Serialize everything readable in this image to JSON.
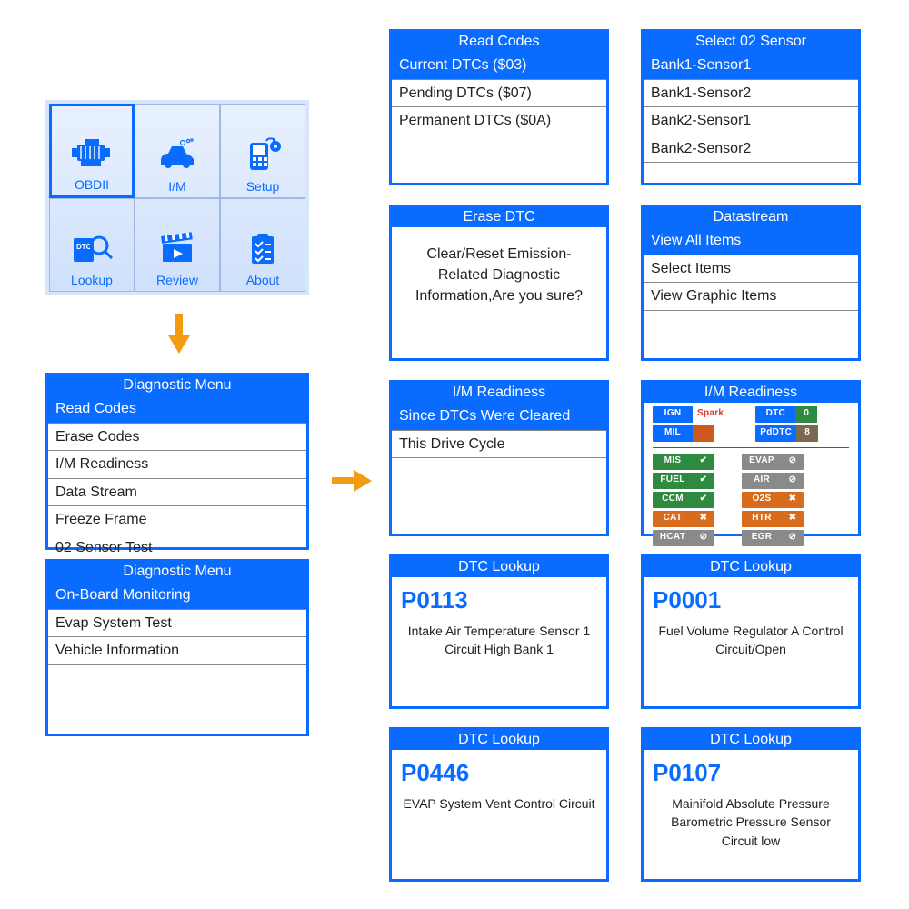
{
  "main_menu": {
    "items": [
      {
        "label": "OBDII",
        "selected": true
      },
      {
        "label": "I/M",
        "selected": false
      },
      {
        "label": "Setup",
        "selected": false
      },
      {
        "label": "Lookup",
        "selected": false
      },
      {
        "label": "Review",
        "selected": false
      },
      {
        "label": "About",
        "selected": false
      }
    ]
  },
  "diag_menu_1": {
    "title": "Diagnostic Menu",
    "items": [
      "Read Codes",
      "Erase Codes",
      "I/M Readiness",
      "Data Stream",
      "Freeze Frame",
      "02 Sensor Test"
    ],
    "selected_index": 0
  },
  "diag_menu_2": {
    "title": "Diagnostic Menu",
    "items": [
      "On-Board Monitoring",
      "Evap System Test",
      "Vehicle Information"
    ],
    "selected_index": 0
  },
  "read_codes": {
    "title": "Read Codes",
    "items": [
      "Current DTCs ($03)",
      "Pending DTCs ($07)",
      "Permanent DTCs ($0A)"
    ],
    "selected_index": 0
  },
  "select_o2": {
    "title": "Select 02 Sensor",
    "items": [
      "Bank1-Sensor1",
      "Bank1-Sensor2",
      "Bank2-Sensor1",
      "Bank2-Sensor2"
    ],
    "selected_index": 0
  },
  "erase_dtc": {
    "title": "Erase DTC",
    "message": "Clear/Reset Emission-Related Diagnostic Information,Are you sure?"
  },
  "datastream": {
    "title": "Datastream",
    "items": [
      "View All Items",
      "Select Items",
      "View Graphic Items"
    ],
    "selected_index": 0
  },
  "im_ready_menu": {
    "title": "I/M Readiness",
    "items": [
      "Since DTCs Were Cleared",
      "This Drive Cycle"
    ],
    "selected_index": 0
  },
  "im_ready_dash": {
    "title": "I/M Readiness",
    "top_left": [
      {
        "label": "IGN",
        "value": "Spark",
        "label_bg": "#0a6cff",
        "val_bg": "#fff",
        "val_color": "#d33"
      },
      {
        "label": "MIL",
        "value": "",
        "label_bg": "#0a6cff",
        "val_bg": "#cc5a1f"
      }
    ],
    "top_right": [
      {
        "label": "DTC",
        "value": "0",
        "label_bg": "#0a6cff",
        "val_bg": "#2d8a3e"
      },
      {
        "label": "PdDTC",
        "value": "8",
        "label_bg": "#0a6cff",
        "val_bg": "#7a6b50"
      }
    ],
    "left": [
      {
        "label": "MIS",
        "status": "ok",
        "bg": "#2d8a3e"
      },
      {
        "label": "FUEL",
        "status": "ok",
        "bg": "#2d8a3e"
      },
      {
        "label": "CCM",
        "status": "ok",
        "bg": "#2d8a3e"
      },
      {
        "label": "CAT",
        "status": "x",
        "bg": "#d96c1c"
      },
      {
        "label": "HCAT",
        "status": "na",
        "bg": "#8a8a8a"
      }
    ],
    "right": [
      {
        "label": "EVAP",
        "status": "na",
        "bg": "#8a8a8a"
      },
      {
        "label": "AIR",
        "status": "na",
        "bg": "#8a8a8a"
      },
      {
        "label": "O2S",
        "status": "x",
        "bg": "#d96c1c"
      },
      {
        "label": "HTR",
        "status": "x",
        "bg": "#d96c1c"
      },
      {
        "label": "EGR",
        "status": "na",
        "bg": "#8a8a8a"
      }
    ]
  },
  "dtc_lookup": {
    "title": "DTC Lookup",
    "cards": [
      {
        "code": "P0113",
        "text": "Intake Air Temperature Sensor 1 Circuit High Bank 1"
      },
      {
        "code": "P0001",
        "text": "Fuel Volume Regulator A Control Circuit/Open"
      },
      {
        "code": "P0446",
        "text": "EVAP System Vent Control Circuit"
      },
      {
        "code": "P0107",
        "text": "Mainifold Absolute Pressure Barometric Pressure Sensor Circuit low"
      }
    ]
  }
}
